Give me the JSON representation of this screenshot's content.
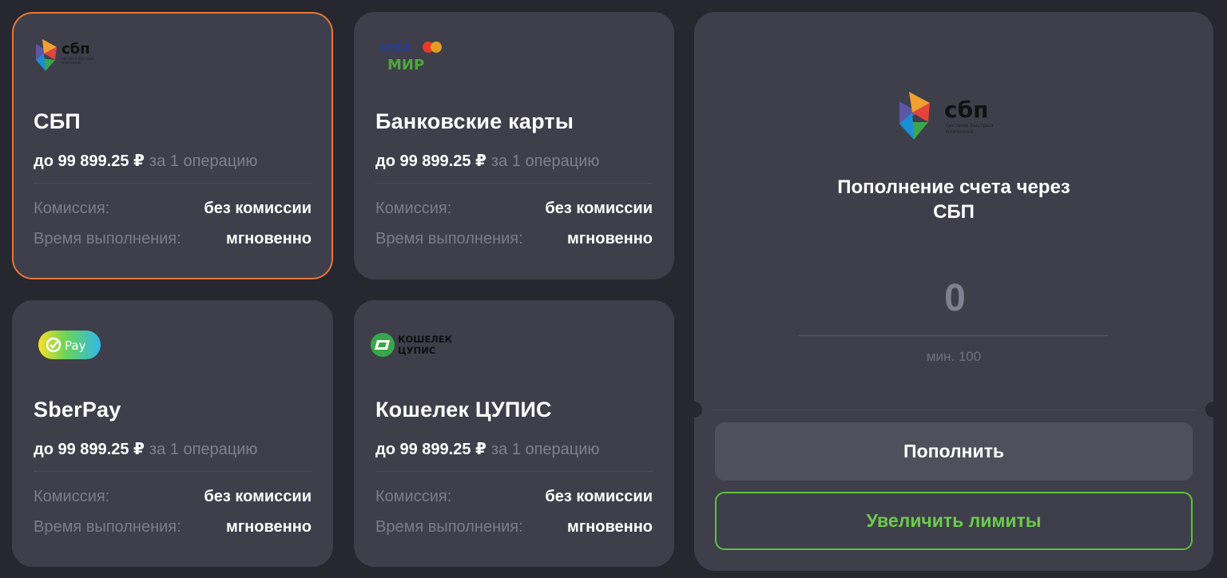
{
  "colors": {
    "background": "#26272f",
    "card": "#3e3f4b",
    "selected_border": "#e8763a",
    "accent_green": "#6ccc4a"
  },
  "methods": [
    {
      "title": "СБП",
      "logo": "sbp-logo",
      "logo_text": "сбп",
      "logo_subtext": "система быстрых платежей",
      "limit": "до 99 899.25 ₽",
      "limit_suffix": "за 1 операцию",
      "fee_label": "Комиссия:",
      "fee_value": "без комиссии",
      "time_label": "Время выполнения:",
      "time_value": "мгновенно",
      "selected": true
    },
    {
      "title": "Банковские карты",
      "logo": "visa-mastercard-mir-logo",
      "logo_text_1": "VISA",
      "logo_text_2": "МИР",
      "limit": "до 99 899.25 ₽",
      "limit_suffix": "за 1 операцию",
      "fee_label": "Комиссия:",
      "fee_value": "без комиссии",
      "time_label": "Время выполнения:",
      "time_value": "мгновенно",
      "selected": false
    },
    {
      "title": "SberPay",
      "logo": "sberpay-logo",
      "logo_text": "Pay",
      "limit": "до 99 899.25 ₽",
      "limit_suffix": "за 1 операцию",
      "fee_label": "Комиссия:",
      "fee_value": "без комиссии",
      "time_label": "Время выполнения:",
      "time_value": "мгновенно",
      "selected": false
    },
    {
      "title": "Кошелек ЦУПИС",
      "logo": "cupis-wallet-logo",
      "logo_text_1": "КОШЕЛЕК",
      "logo_text_2": "ЦУПИС",
      "limit": "до 99 899.25 ₽",
      "limit_suffix": "за 1 операцию",
      "fee_label": "Комиссия:",
      "fee_value": "без комиссии",
      "time_label": "Время выполнения:",
      "time_value": "мгновенно",
      "selected": false
    }
  ],
  "panel": {
    "logo": "sbp-logo",
    "logo_text": "сбп",
    "logo_subtext_1": "система быстрых",
    "logo_subtext_2": "платежей",
    "title_line1": "Пополнение счета через",
    "title_line2": "СБП",
    "amount": "0",
    "min_hint": "мин. 100",
    "submit_label": "Пополнить",
    "limits_label": "Увеличить лимиты"
  }
}
